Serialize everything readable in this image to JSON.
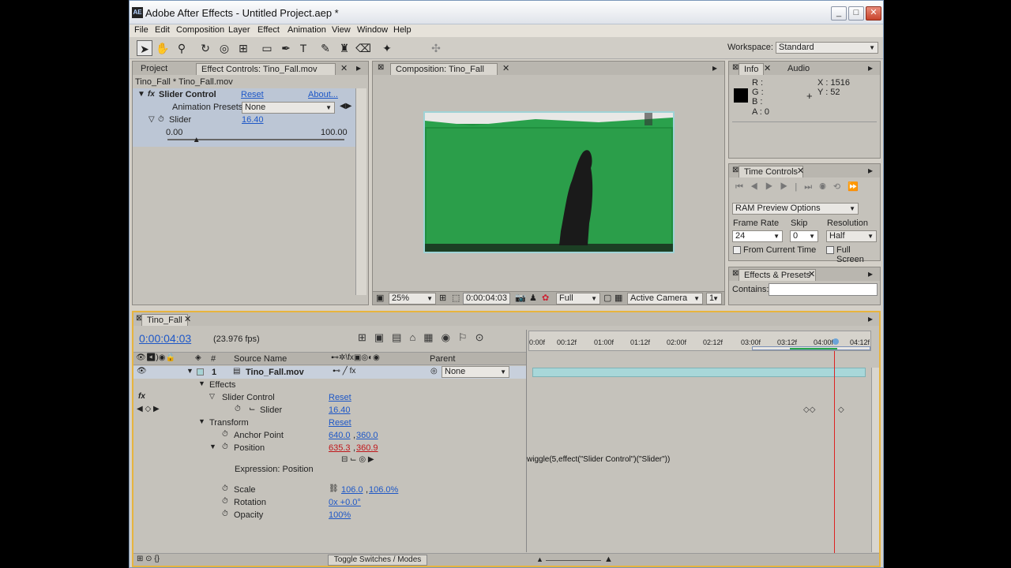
{
  "app": {
    "title": "Adobe After Effects - Untitled Project.aep *",
    "logo": "AE",
    "window_buttons": [
      "_",
      "□",
      "✕"
    ]
  },
  "menu": [
    "File",
    "Edit",
    "Composition",
    "Layer",
    "Effect",
    "Animation",
    "View",
    "Window",
    "Help"
  ],
  "workspace": {
    "label": "Workspace:",
    "value": "Standard"
  },
  "project_panel": {
    "tab_project": "Project",
    "tab_effect_controls": "Effect Controls: Tino_Fall.mov",
    "breadcrumb": "Tino_Fall * Tino_Fall.mov",
    "effect_name": "Slider Control",
    "reset": "Reset",
    "about": "About...",
    "presets_label": "Animation Presets:",
    "presets_value": "None",
    "slider_label": "Slider",
    "slider_value": "16.40",
    "slider_min": "0.00",
    "slider_max": "100.00",
    "slider_fraction": 0.164
  },
  "composition_panel": {
    "tab": "Composition: Tino_Fall",
    "zoom": "25%",
    "timecode": "0:00:04:03",
    "resolution": "Full",
    "camera": "Active Camera",
    "extra": "1"
  },
  "info_panel": {
    "tab_info": "Info",
    "tab_audio": "Audio",
    "r": "R :",
    "g": "G :",
    "b": "B :",
    "a": "A : 0",
    "x": "X : 1516",
    "y": "Y : 52"
  },
  "time_controls": {
    "tab": "Time Controls",
    "ram_preview": "RAM Preview Options",
    "frame_rate_label": "Frame Rate",
    "frame_rate": "24",
    "skip_label": "Skip",
    "skip": "0",
    "resolution_label": "Resolution",
    "resolution": "Half",
    "from_current": "From Current Time",
    "full_screen": "Full Screen"
  },
  "effects_presets": {
    "tab": "Effects & Presets",
    "contains_label": "Contains:"
  },
  "timeline": {
    "tab": "Tino_Fall",
    "timecode": "0:00:04:03",
    "fps": "(23.976 fps)",
    "col_number": "#",
    "col_source": "Source Name",
    "col_parent": "Parent",
    "layer_number": "1",
    "layer_name": "Tino_Fall.mov",
    "parent_value": "None",
    "effects": "Effects",
    "fx_badge": "fx",
    "slider_control": "Slider Control",
    "reset": "Reset",
    "slider": "Slider",
    "slider_value": "16.40",
    "transform": "Transform",
    "anchor_point": "Anchor Point",
    "anchor_value_x": "640.0",
    "anchor_value_y": "360.0",
    "position": "Position",
    "position_x": "635.3",
    "position_y": "360.9",
    "expression_label": "Expression: Position",
    "expression": "wiggle(5,effect(\"Slider Control\")(\"Slider\"))",
    "scale": "Scale",
    "scale_x": "106.0",
    "scale_y": "106.0%",
    "rotation": "Rotation",
    "rotation_value": "0x +0.0°",
    "opacity": "Opacity",
    "opacity_value": "100%",
    "toggle": "Toggle Switches / Modes",
    "ruler": [
      "0:00f",
      "00:12f",
      "01:00f",
      "01:12f",
      "02:00f",
      "02:12f",
      "03:00f",
      "03:12f",
      "04:00f",
      "04:12f"
    ]
  }
}
